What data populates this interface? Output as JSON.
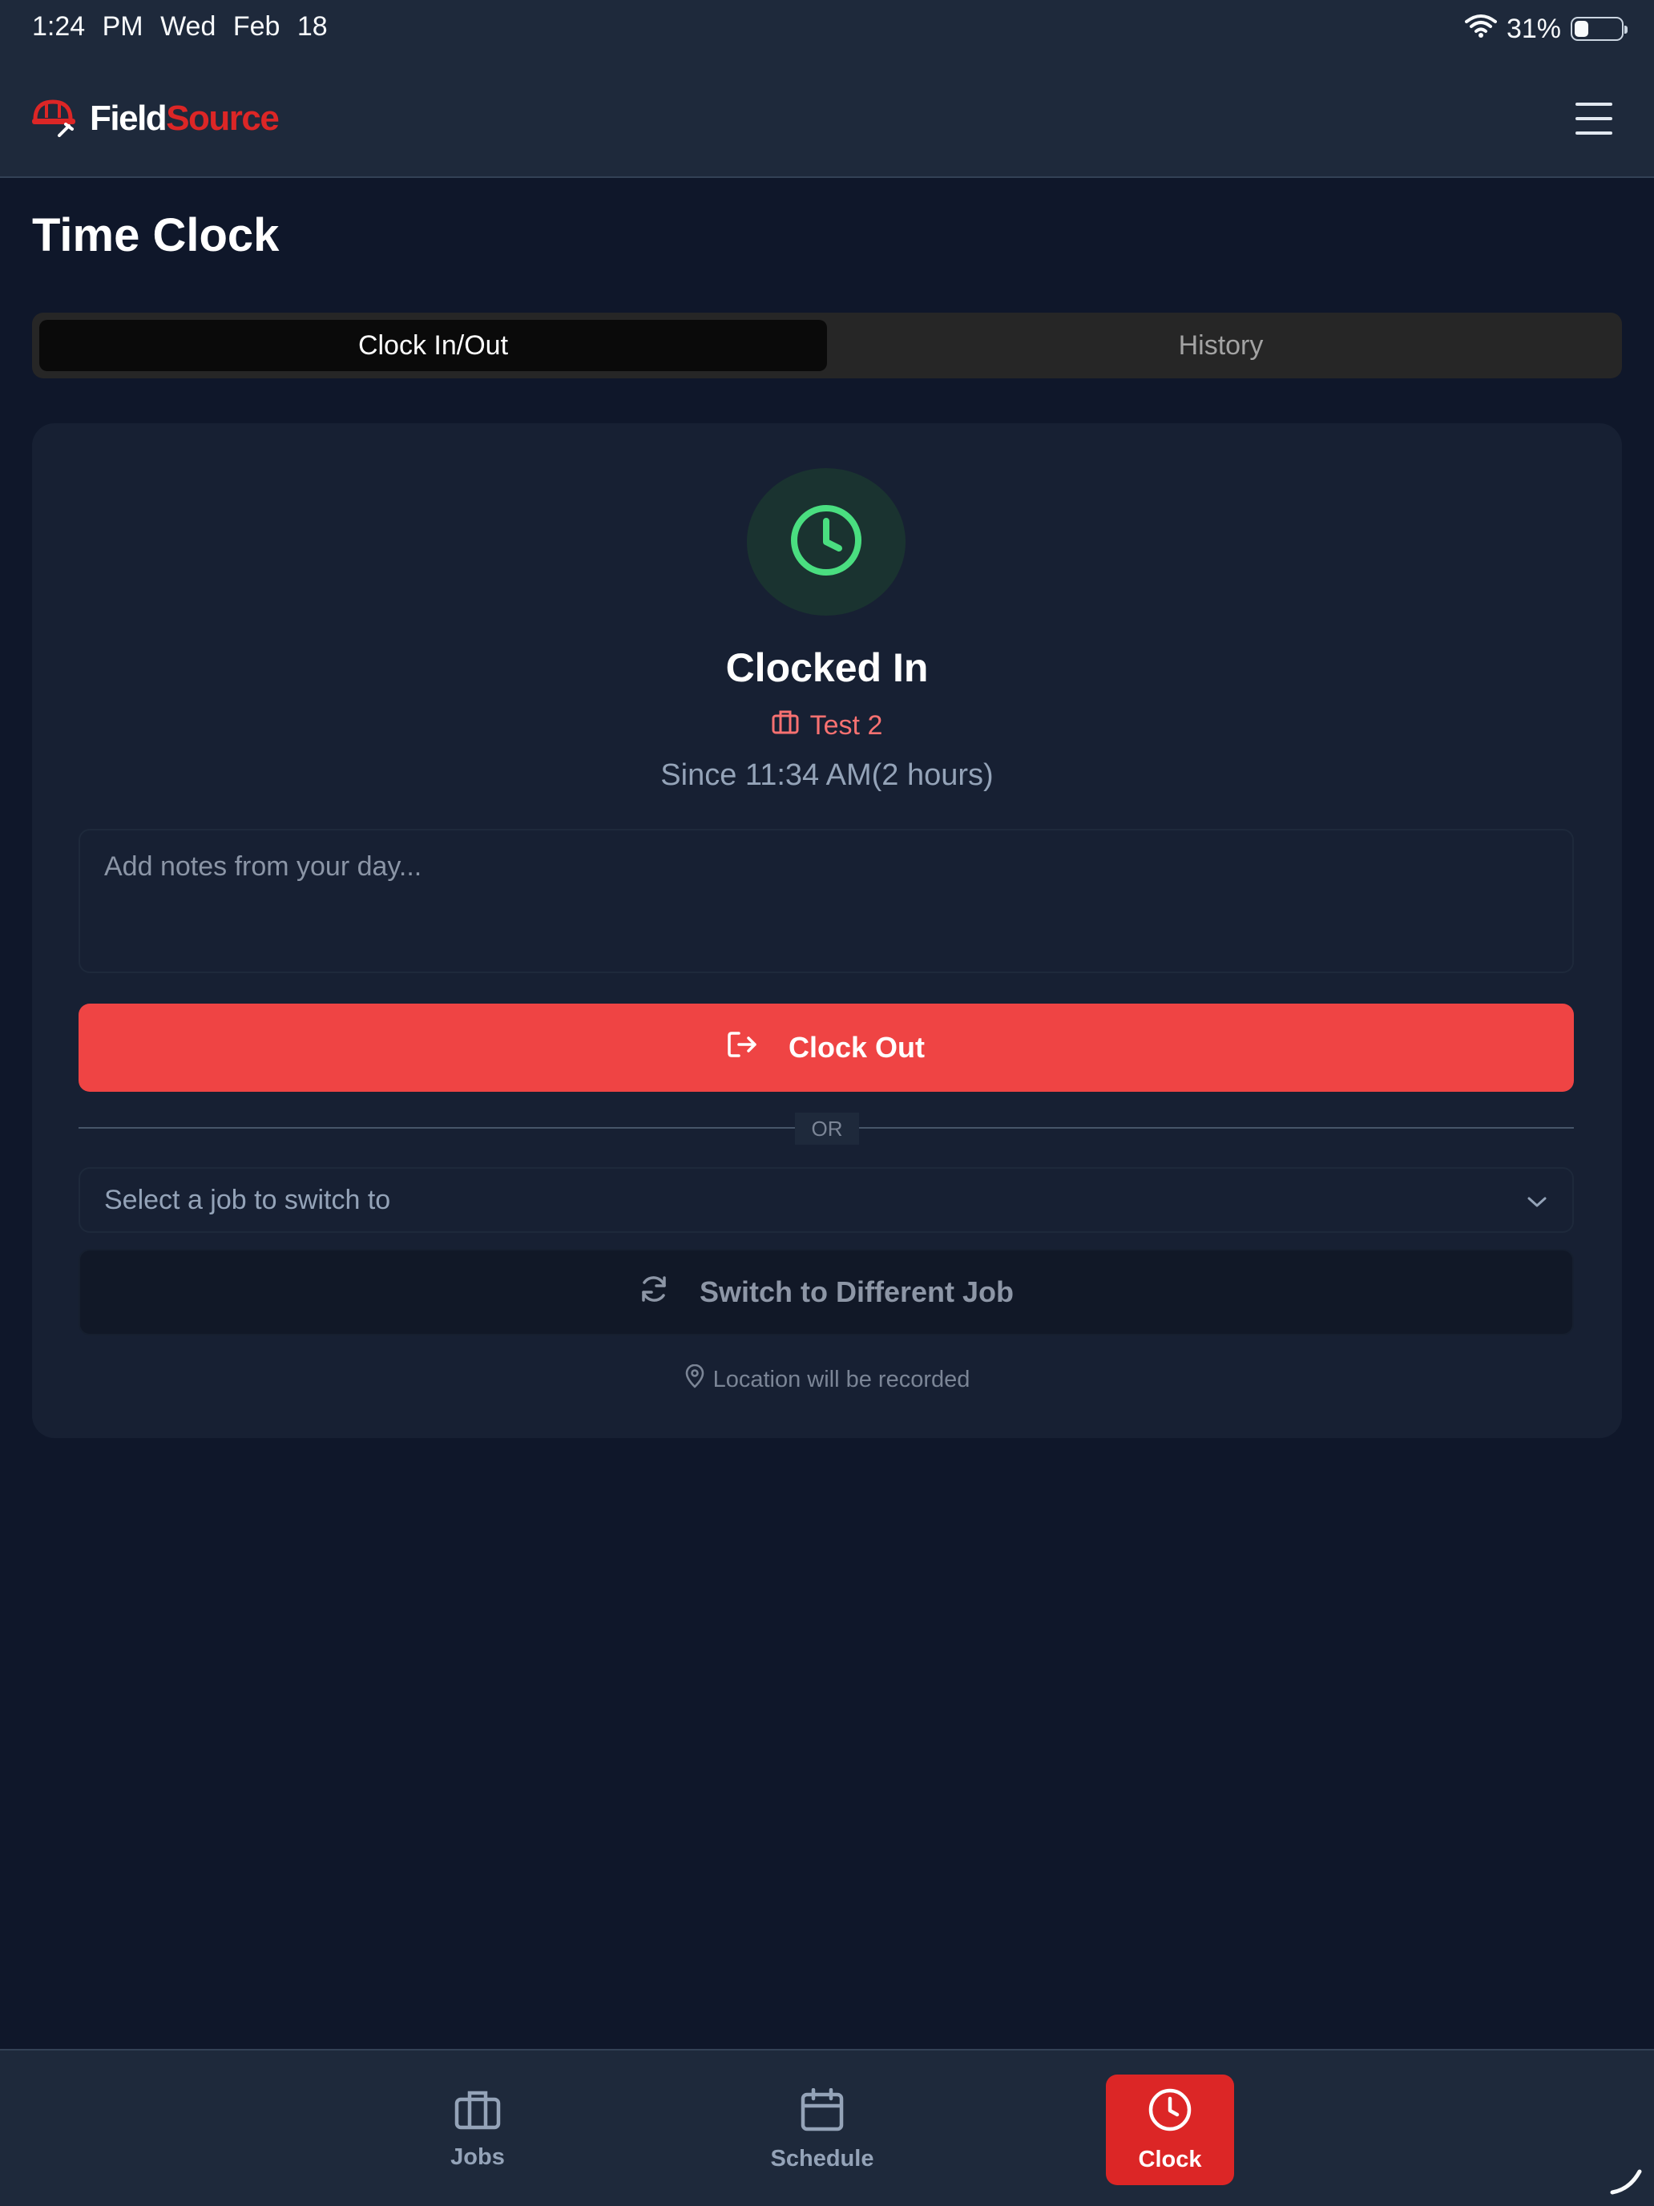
{
  "status_bar": {
    "time": "1:24 PM",
    "date": "Wed Feb 18",
    "battery_percent": "31%",
    "battery_level": 0.31,
    "icons": [
      "wifi-icon",
      "battery-icon"
    ]
  },
  "header": {
    "brand_part1": "Field",
    "brand_part2": "Source",
    "logo_icon": "hard-hat-icon",
    "menu_icon": "hamburger-menu-icon"
  },
  "page": {
    "title": "Time Clock"
  },
  "tabs": [
    {
      "label": "Clock In/Out",
      "active": true
    },
    {
      "label": "History",
      "active": false
    }
  ],
  "clock_card": {
    "status_icon": "clock-icon",
    "status": "Clocked In",
    "job_icon": "briefcase-icon",
    "job_name": "Test 2",
    "since": "Since 11:34 AM(2 hours)",
    "notes_placeholder": "Add notes from your day...",
    "notes_value": "",
    "clock_out_label": "Clock Out",
    "clock_out_icon": "log-out-icon",
    "divider_label": "OR",
    "job_select_placeholder": "Select a job to switch to",
    "job_select_icon": "chevron-down-icon",
    "switch_label": "Switch to Different Job",
    "switch_icon": "refresh-icon",
    "location_icon": "map-pin-icon",
    "location_note": "Location will be recorded"
  },
  "bottom_nav": [
    {
      "label": "Jobs",
      "icon": "briefcase-icon",
      "active": false
    },
    {
      "label": "Schedule",
      "icon": "calendar-icon",
      "active": false
    },
    {
      "label": "Clock",
      "icon": "clock-icon",
      "active": true
    }
  ],
  "colors": {
    "background": "#0f172a",
    "header": "#1e293b",
    "brand_red": "#dc2626",
    "danger_button": "#ef4444",
    "success_green": "#4ade80",
    "job_text": "#f87171"
  }
}
